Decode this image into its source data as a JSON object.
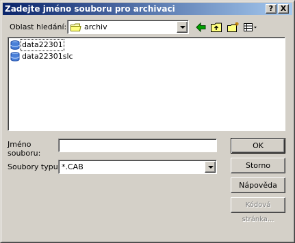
{
  "window": {
    "title": "Zadejte jméno souboru pro archivaci",
    "help_button": "?",
    "close_button": "X"
  },
  "lookin": {
    "label": "Oblast hledání:",
    "value": "archiv",
    "icons": [
      "back-arrow-icon",
      "up-folder-icon",
      "new-folder-icon",
      "view-menu-icon"
    ]
  },
  "files": [
    {
      "name": "data22301",
      "icon": "database-file-icon",
      "selected": true
    },
    {
      "name": "data22301slc",
      "icon": "database-file-icon",
      "selected": false
    }
  ],
  "filename": {
    "label": "Jméno souboru:",
    "value": ""
  },
  "filetype": {
    "label": "Soubory typu:",
    "value": "*.CAB"
  },
  "buttons": {
    "ok": "OK",
    "cancel": "Storno",
    "help": "Nápověda",
    "codepage": "Kódová stránka..."
  },
  "colors": {
    "titlebar_start": "#0a246a",
    "titlebar_end": "#a6caf0",
    "face": "#d4d0c8"
  }
}
